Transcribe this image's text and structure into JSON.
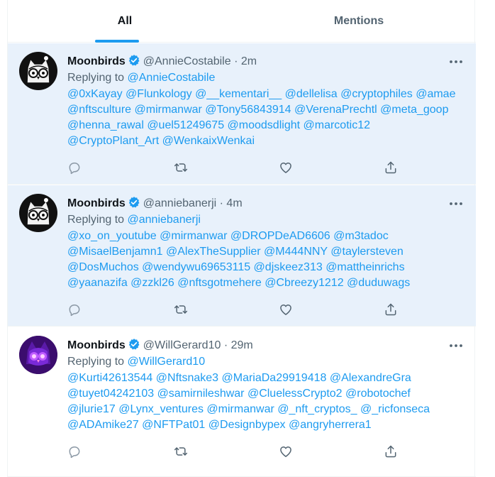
{
  "tabs": {
    "all": "All",
    "mentions": "Mentions"
  },
  "tweets": [
    {
      "name": "Moonbirds",
      "handle": "@AnnieCostabile",
      "time": "· 2m",
      "replying_prefix": "Replying to",
      "replying_to": "@AnnieCostabile",
      "unread": true,
      "avatar": "moonbird-owl-white",
      "lines": [
        "@0xKayay @Flunkology @__kementari__ @dellelisa @cryptophiles @amae",
        "@nftsculture @mirmanwar @Tony56843914 @VerenaPrechtl @meta_goop",
        "@henna_rawal @uel51249675 @moodsdlight @marcotic12",
        "@CryptoPlant_Art @WenkaixWenkai"
      ]
    },
    {
      "name": "Moonbirds",
      "handle": "@anniebanerji",
      "time": "· 4m",
      "replying_prefix": "Replying to",
      "replying_to": "@anniebanerji",
      "unread": true,
      "avatar": "moonbird-owl-white",
      "lines": [
        "@xo_on_youtube @mirmanwar @DROPDeAD6606 @m3tadoc",
        "@MisaelBenjamn1 @AlexTheSupplier @M444NNY @taylersteven",
        "@DosMuchos @wendywu69653115 @djskeez313 @mattheinrichs",
        "@yaanazifa @zzkl26 @nftsgotmehere @Cbreezy1212 @duduwags"
      ]
    },
    {
      "name": "Moonbirds",
      "handle": "@WillGerard10",
      "time": "· 29m",
      "replying_prefix": "Replying to",
      "replying_to": "@WillGerard10",
      "unread": false,
      "avatar": "moonbird-owl-purple",
      "lines": [
        "@Kurti42613544 @Nftsnake3 @MariaDa29919418 @AlexandreGra",
        "@tuyet04242103 @samirnileshwar @CluelessCrypto2 @robotochef",
        "@jlurie17 @Lynx_ventures @mirmanwar @_nft_cryptos_ @_ricfonseca",
        "@ADAmike27 @NFTPat01 @Designbypex @angryherrera1"
      ]
    }
  ],
  "colors": {
    "accent": "#1d9bf0",
    "unread_bg": "#e8f1fb",
    "muted": "#536471"
  }
}
